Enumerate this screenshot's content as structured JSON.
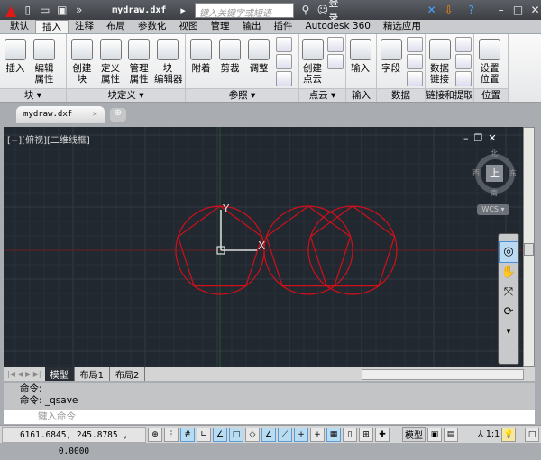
{
  "titlebar": {
    "file": "mydraw.dxf",
    "search_placeholder": "键入关键字或短语",
    "login": "登录"
  },
  "ribbon_tabs": [
    "默认",
    "插入",
    "注释",
    "布局",
    "参数化",
    "视图",
    "管理",
    "输出",
    "插件",
    "Autodesk 360",
    "精选应用"
  ],
  "active_tab": "插入",
  "panels": [
    {
      "label": "块 ▾",
      "buttons": [
        "插入",
        "编辑\n属性"
      ]
    },
    {
      "label": "块定义 ▾",
      "buttons": [
        "创建\n块",
        "定义\n属性",
        "管理\n属性",
        "块\n编辑器"
      ]
    },
    {
      "label": "参照 ▾",
      "buttons": [
        "附着",
        "剪裁",
        "调整"
      ]
    },
    {
      "label": "点云 ▾",
      "buttons": [
        "创建\n点云"
      ]
    },
    {
      "label": "输入",
      "buttons": [
        "输入"
      ]
    },
    {
      "label": "数据",
      "buttons": [
        "字段"
      ]
    },
    {
      "label": "链接和提取",
      "buttons": [
        "数据\n链接"
      ]
    },
    {
      "label": "位置",
      "buttons": [
        "设置\n位置"
      ]
    }
  ],
  "doc_tab": "mydraw.dxf",
  "viewport": {
    "label": "[−][俯视][二维线框]",
    "viewcube": {
      "top": "上",
      "n": "北",
      "s": "南",
      "e": "东",
      "w": "西"
    },
    "wcs": "WCS",
    "ucs_y": "Y",
    "ucs_x": "X",
    "colors": {
      "geometry": "#d0101a",
      "background": "#212830"
    }
  },
  "layout_tabs": [
    "模型",
    "布局1",
    "布局2"
  ],
  "command": {
    "history": [
      "命令:",
      "命令:  _qsave"
    ],
    "placeholder": "键入命令"
  },
  "status": {
    "coords": "6161.6845,   245.8785   , 0.0000",
    "model": "模型",
    "scale": "1:1"
  }
}
